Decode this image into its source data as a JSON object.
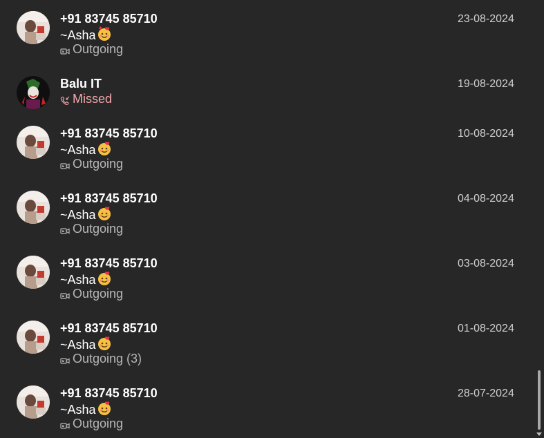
{
  "calls": [
    {
      "name": "+91 83745 85710",
      "subname": "~Asha",
      "status": "Outgoing",
      "date": "23-08-2024",
      "type": "outgoing"
    },
    {
      "name": "Balu IT",
      "subname": "",
      "status": "Missed",
      "date": "19-08-2024",
      "type": "missed"
    },
    {
      "name": "+91 83745 85710",
      "subname": "~Asha",
      "status": "Outgoing",
      "date": "10-08-2024",
      "type": "outgoing"
    },
    {
      "name": "+91 83745 85710",
      "subname": "~Asha",
      "status": "Outgoing",
      "date": "04-08-2024",
      "type": "outgoing"
    },
    {
      "name": "+91 83745 85710",
      "subname": "~Asha",
      "status": "Outgoing",
      "date": "03-08-2024",
      "type": "outgoing"
    },
    {
      "name": "+91 83745 85710",
      "subname": "~Asha",
      "status": "Outgoing (3)",
      "date": "01-08-2024",
      "type": "outgoing"
    },
    {
      "name": "+91 83745 85710",
      "subname": "~Asha",
      "status": "Outgoing",
      "date": "28-07-2024",
      "type": "outgoing"
    }
  ],
  "colors": {
    "background": "#272727",
    "missed": "#f4a8ad",
    "secondary": "#b7b7b7"
  },
  "icons": {
    "outgoing": "video-call-icon",
    "missed": "missed-call-icon",
    "emoji": "smiling-face-with-hearts-icon"
  }
}
